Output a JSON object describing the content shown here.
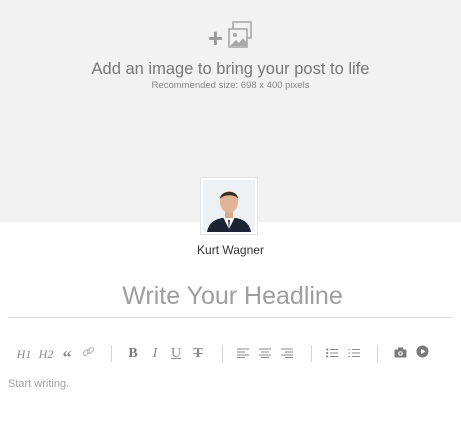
{
  "cover": {
    "prompt": "Add an image to bring your post to life",
    "recommendation": "Recommended size: 698 x 400 pixels",
    "plus_symbol": "+",
    "icons": [
      "plus-icon",
      "image-icon"
    ]
  },
  "author": {
    "name": "Kurt Wagner"
  },
  "headline": {
    "placeholder": "Write Your Headline"
  },
  "toolbar": {
    "h1": "H1",
    "h2": "H2",
    "quote": "“",
    "bold": "B",
    "italic": "I",
    "underline": "U",
    "strike": "T",
    "icons": [
      "link-icon",
      "align-left-icon",
      "align-center-icon",
      "align-right-icon",
      "bullet-list-icon",
      "numbered-list-icon",
      "camera-icon",
      "play-icon"
    ]
  },
  "body": {
    "placeholder": "Start writing."
  }
}
